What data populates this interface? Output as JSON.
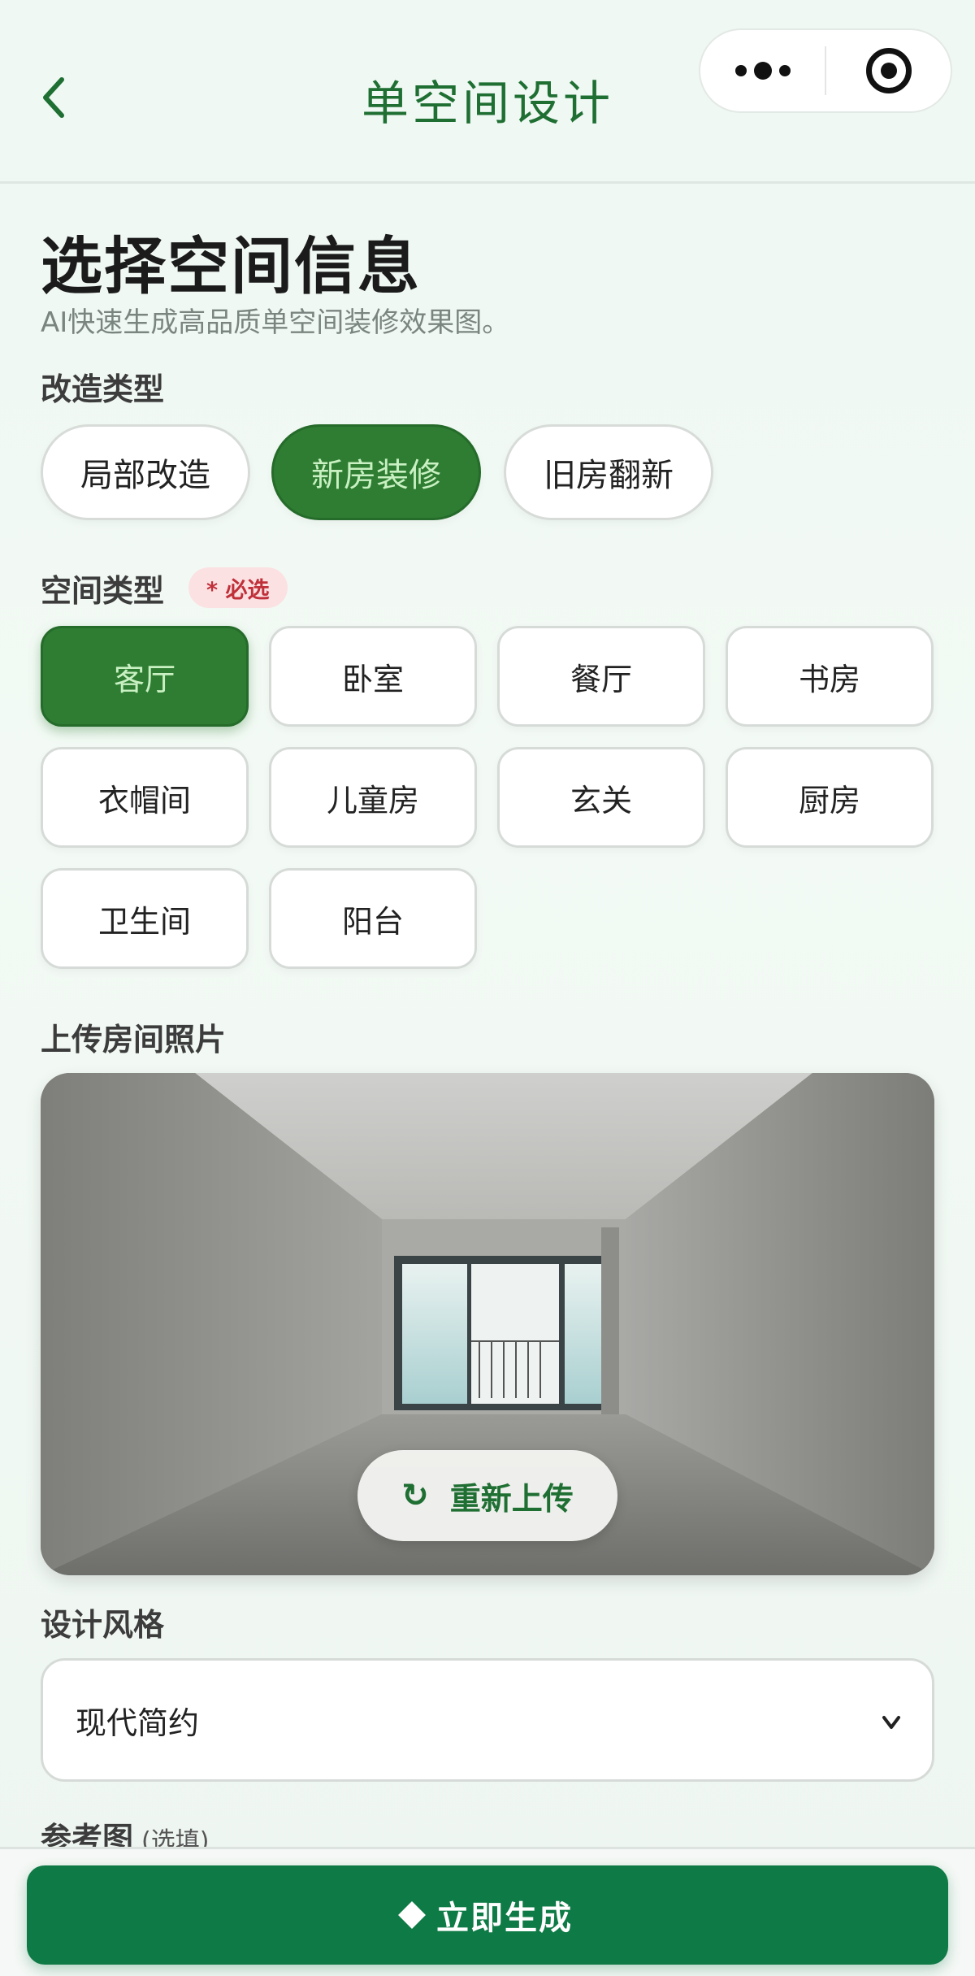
{
  "navbar": {
    "title": "单空间设计",
    "back_icon": "chevron-left-icon",
    "more_icon": "more-dots-icon",
    "close_icon": "record-target-icon"
  },
  "header": {
    "title": "选择空间信息",
    "subtitle": "AI快速生成高品质单空间装修效果图。"
  },
  "renovation_type": {
    "label": "改造类型",
    "options": [
      "局部改造",
      "新房装修",
      "旧房翻新"
    ],
    "selected": "新房装修"
  },
  "space_type": {
    "label": "空间类型",
    "required_badge": "* 必选",
    "options": [
      "客厅",
      "卧室",
      "餐厅",
      "书房",
      "衣帽间",
      "儿童房",
      "玄关",
      "厨房",
      "卫生间",
      "阳台"
    ],
    "selected": "客厅"
  },
  "upload": {
    "label": "上传房间照片",
    "reupload_label": "重新上传",
    "reupload_icon": "refresh-icon"
  },
  "design_style": {
    "label": "设计风格",
    "value": "现代简约",
    "chevron": "v"
  },
  "reference": {
    "label": "参考图",
    "optional": "(选填)"
  },
  "footer": {
    "generate_label": "立即生成",
    "generate_icon": "diamond-icon"
  },
  "colors": {
    "primary_green": "#2e7d32",
    "button_green": "#0e7a45",
    "title_green": "#1f6f33",
    "badge_bg": "#fbe1e2",
    "badge_text": "#c0303a"
  }
}
